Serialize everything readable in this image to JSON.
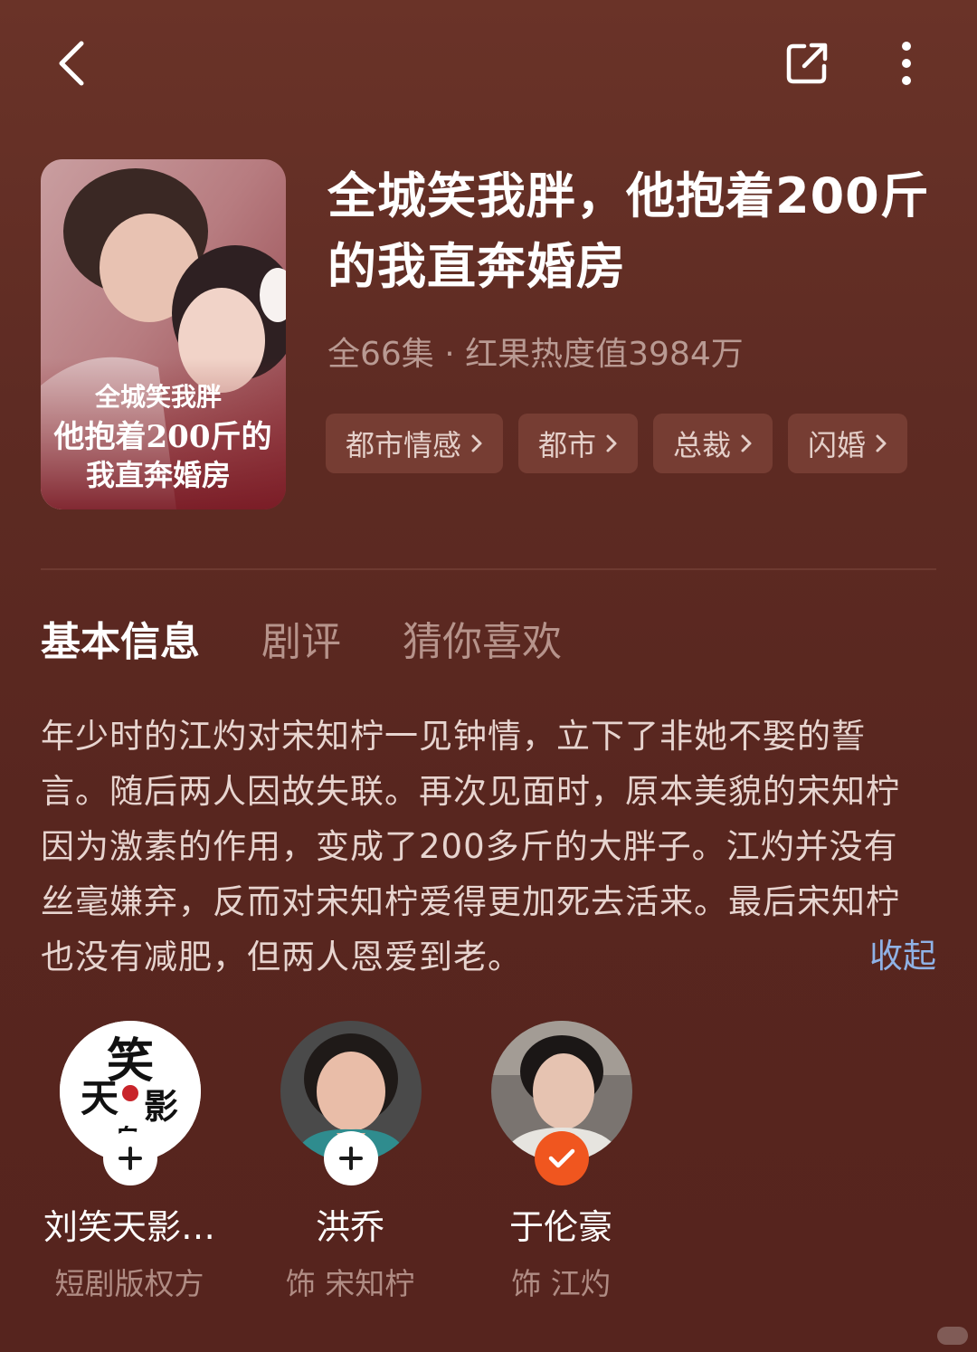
{
  "header": {
    "back_icon": "chevron-left-icon",
    "share_icon": "share-external-icon",
    "more_icon": "more-vertical-icon"
  },
  "drama": {
    "poster_text_line1": "全城笑我胖",
    "poster_text_line2": "他抱着200斤的",
    "poster_text_line3": "我直奔婚房",
    "title_line1": "全城笑我胖，他抱着200斤",
    "title_line2": "的我直奔婚房",
    "meta": "全66集 · 红果热度值3984万",
    "tags": [
      "都市情感",
      "都市",
      "总裁",
      "闪婚"
    ]
  },
  "tabs": [
    "基本信息",
    "剧评",
    "猜你喜欢"
  ],
  "active_tab": "基本信息",
  "synopsis": {
    "lines": [
      "年少时的江灼对宋知柠一见钟情，立下了非她不娶的誓",
      "言。随后两人因故失联。再次见面时，原本美貌的宋知柠",
      "因为激素的作用，变成了200多斤的大胖子。江灼并没有",
      "丝毫嫌弃，反而对宋知柠爱得更加死去活来。最后宋知柠",
      "也没有减肥，但两人恩爱到老。"
    ],
    "collapse_label": "收起"
  },
  "cast": [
    {
      "name": "刘笑天影…",
      "role": "短剧版权方",
      "followed": false,
      "logo_text": "笑天影"
    },
    {
      "name": "洪乔",
      "role": "饰 宋知柠",
      "followed": false
    },
    {
      "name": "于伦豪",
      "role": "饰 江灼",
      "followed": true
    }
  ],
  "colors": {
    "background": "#5e2b23",
    "tag_bg": "#763d33",
    "accent_follow": "#f0561f",
    "link": "#8fb2e6"
  }
}
